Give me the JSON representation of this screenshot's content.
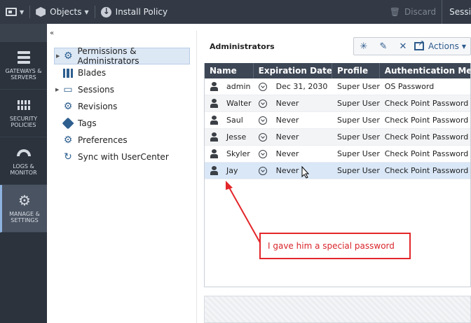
{
  "toolbar": {
    "menu_icon": "app-menu-icon",
    "objects_label": "Objects",
    "install_policy_label": "Install Policy",
    "discard_label": "Discard",
    "session_label": "Sessi"
  },
  "leftnav": {
    "items": [
      {
        "label": "GATEWAYS & SERVERS",
        "icon": "server-icon"
      },
      {
        "label": "SECURITY POLICIES",
        "icon": "firewall-icon"
      },
      {
        "label": "LOGS & MONITOR",
        "icon": "gauge-icon"
      },
      {
        "label": "MANAGE & SETTINGS",
        "icon": "gear-icon",
        "active": true
      }
    ]
  },
  "tree": {
    "items": [
      {
        "label": "Permissions & Administrators",
        "icon": "gear-icon",
        "expandable": true,
        "selected": true
      },
      {
        "label": "Blades",
        "icon": "blades-icon"
      },
      {
        "label": "Sessions",
        "icon": "sessions-icon",
        "expandable": true
      },
      {
        "label": "Revisions",
        "icon": "gear-icon"
      },
      {
        "label": "Tags",
        "icon": "tag-icon"
      },
      {
        "label": "Preferences",
        "icon": "gear-icon"
      },
      {
        "label": "Sync with UserCenter",
        "icon": "sync-icon"
      }
    ]
  },
  "main": {
    "title": "Administrators",
    "actions_label": "Actions",
    "columns": [
      "Name",
      "Expiration Date",
      "Profile",
      "Authentication Metho"
    ],
    "rows": [
      {
        "name": "admin",
        "expiration": "Dec 31, 2030",
        "profile": "Super User",
        "auth": "OS Password"
      },
      {
        "name": "Walter",
        "expiration": "Never",
        "profile": "Super User",
        "auth": "Check Point Password"
      },
      {
        "name": "Saul",
        "expiration": "Never",
        "profile": "Super User",
        "auth": "Check Point Password"
      },
      {
        "name": "Jesse",
        "expiration": "Never",
        "profile": "Super User",
        "auth": "Check Point Password"
      },
      {
        "name": "Skyler",
        "expiration": "Never",
        "profile": "Super User",
        "auth": "Check Point Password"
      },
      {
        "name": "Jay",
        "expiration": "Never",
        "profile": "Super User",
        "auth": "Check Point Password"
      }
    ]
  },
  "annotation": {
    "text": "I gave him a special password",
    "color": "#e3262a"
  }
}
